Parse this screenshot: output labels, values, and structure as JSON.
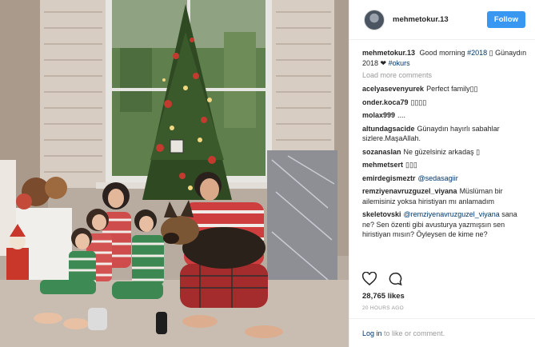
{
  "post": {
    "username": "mehmetokur.13",
    "follow_label": "Follow",
    "caption_user": "mehmetokur.13",
    "caption_text_1": "Good morning",
    "caption_tag_1": "#2018",
    "caption_emoji": "▯",
    "caption_text_2": "Günaydın 2018 ❤",
    "caption_tag_2": "#okurs",
    "load_more": "Load more comments",
    "likes": "28,765 likes",
    "timestamp": "20 HOURS AGO",
    "login_link": "Log in",
    "login_rest": "to like or comment."
  },
  "comments": [
    {
      "user": "acelyasevenyurek",
      "text": "Perfect family▯▯"
    },
    {
      "user": "onder.koca79",
      "text": "▯▯▯▯"
    },
    {
      "user": "molax999",
      "text": "...."
    },
    {
      "user": "altundagsacide",
      "text": "Günaydın hayırlı sabahlar sizlere.MaşaAllah."
    },
    {
      "user": "sozanaslan",
      "text": "Ne güzelsiniz arkadaş ▯"
    },
    {
      "user": "mehmetsert",
      "text": "▯▯▯"
    },
    {
      "user": "emirdegismeztr",
      "mention": "@sedasagiir",
      "text": ""
    },
    {
      "user": "remziyenavruzguzel_viyana",
      "text": "Müslüman bir ailemisiniz yoksa hiristiyan mı anlamadım"
    },
    {
      "user": "skeletovski",
      "mention": "@remziyenavruzguzel_viyana",
      "text": "sana ne? Sen özenti gibi avusturya yazmışsın sen hiristiyan mısın? Öyleysen de kime ne?"
    }
  ],
  "icons": {
    "heart": "heart-icon",
    "comment": "comment-bubble-icon"
  },
  "colors": {
    "accent": "#3897f0",
    "link": "#003569",
    "muted": "#999999"
  }
}
